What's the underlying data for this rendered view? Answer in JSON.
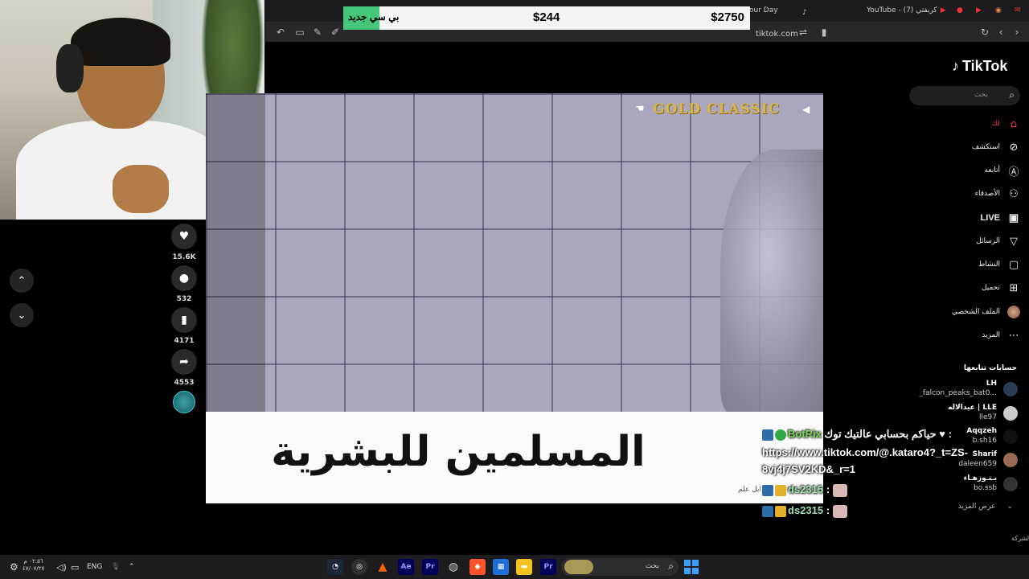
{
  "browser": {
    "tabs": [
      {
        "label": "our Day"
      },
      {
        "label": "YouTube - (7) كريفتي"
      }
    ],
    "address": "tiktok.com"
  },
  "price_overlay": {
    "label": "بي سي جديد",
    "mid_price": "$244",
    "right_price": "$2750",
    "accent": "#44c77a"
  },
  "video": {
    "brand": "GOLD CLASSIC",
    "caption": "المسلمين للبشرية",
    "watermark": "ابل علم"
  },
  "actions": [
    {
      "icon": "heart-icon",
      "count": "15.6K"
    },
    {
      "icon": "comment-icon",
      "count": "532"
    },
    {
      "icon": "bookmark-icon",
      "count": "4171"
    },
    {
      "icon": "share-icon",
      "count": "4553"
    }
  ],
  "tiktok": {
    "logo": "TikTok",
    "search_placeholder": "بحث",
    "nav": [
      {
        "label": "لك",
        "icon": "home-icon",
        "active": true
      },
      {
        "label": "استكشف",
        "icon": "compass-icon"
      },
      {
        "label": "أتابعه",
        "icon": "following-icon"
      },
      {
        "label": "الأصدقاء",
        "icon": "friends-icon"
      },
      {
        "label": "LIVE",
        "icon": "live-icon"
      },
      {
        "label": "الرسائل",
        "icon": "send-icon"
      },
      {
        "label": "النشاط",
        "icon": "activity-icon"
      },
      {
        "label": "تحميل",
        "icon": "upload-icon"
      },
      {
        "label": "الملف الشخصي",
        "icon": "profile-avatar"
      },
      {
        "label": "المزيد",
        "icon": "more-icon"
      }
    ],
    "following_title": "حسابات تتابعها",
    "following": [
      {
        "name": "LH",
        "handle": "_falcon_peaks_bat0..."
      },
      {
        "name": "عبدالاله | LLE",
        "handle": "lle97"
      },
      {
        "name": "Aqqzeh",
        "handle": "b.sh16"
      },
      {
        "name": "Sharif",
        "handle": "daleen659"
      },
      {
        "name": "بـتـوزهـاء",
        "handle": "bo.ssb"
      }
    ],
    "see_more": "عرض المزيد",
    "company": "الشركة"
  },
  "chat": [
    {
      "user": "BotRix",
      "text": "حياكم بحسابي عالتيك توك ♥ :"
    },
    {
      "user": "",
      "text": "https://www.tiktok.com/@.kataro4?_t=ZS-"
    },
    {
      "user": "",
      "text": "8vj4j7SV2KD&_r=1"
    },
    {
      "user": "ds2315",
      "text": ":"
    },
    {
      "user": "ds2315",
      "text": ":"
    }
  ],
  "taskbar": {
    "time": "٠٢:٥٦ م",
    "date": "٤٧/٠٧/٢٧",
    "lang": "ENG",
    "search_placeholder": "بحث",
    "apps": [
      {
        "name": "steam-app",
        "label": ""
      },
      {
        "name": "obs-app",
        "label": ""
      },
      {
        "name": "vlc-app",
        "label": ""
      },
      {
        "name": "after-effects-app",
        "label": "Ae"
      },
      {
        "name": "premiere-app",
        "label": "Pr"
      },
      {
        "name": "chrome-app",
        "label": ""
      },
      {
        "name": "brave-app",
        "label": ""
      },
      {
        "name": "store-app",
        "label": ""
      },
      {
        "name": "explorer-app",
        "label": ""
      },
      {
        "name": "premiere2-app",
        "label": "Pr"
      }
    ]
  }
}
